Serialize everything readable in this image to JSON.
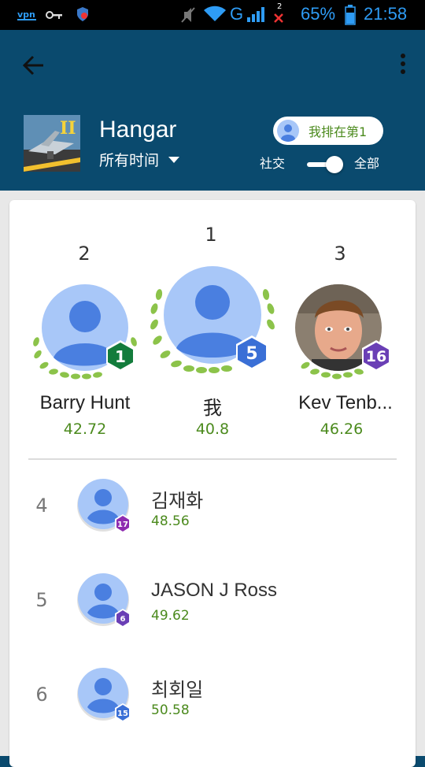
{
  "status_bar": {
    "battery": "65%",
    "time": "21:58",
    "signal_letter": "G",
    "notify_count": "2",
    "icons": [
      "vpn-icon",
      "key-icon",
      "shield-icon",
      "mute-icon",
      "wifi-icon",
      "signal-icon",
      "no-data-icon",
      "battery-icon"
    ]
  },
  "app_bar": {
    "back_icon": "back-arrow-icon",
    "menu_icon": "more-vert-icon",
    "game_title": "Hangar",
    "time_filter": "所有时间",
    "rank_chip": "我排在第1",
    "toggle_left": "社交",
    "toggle_right": "全部",
    "thumb_badge": "II"
  },
  "colors": {
    "app_bar": "#0a4a6e",
    "score_green": "#4b8a1d",
    "laurel": "#8cc34a",
    "avatar_bg": "#a8c7f8",
    "avatar_fg": "#4a7fe0"
  },
  "podium": [
    {
      "rank": "2",
      "name": "Barry Hunt",
      "score": "42.72",
      "level": "1",
      "badge_color": "#137c3c"
    },
    {
      "rank": "1",
      "name": "我",
      "score": "40.8",
      "level": "5",
      "badge_color": "#3a6fd6"
    },
    {
      "rank": "3",
      "name": "Kev Tenb...",
      "score": "46.26",
      "level": "16",
      "badge_color": "#6a3fb5"
    }
  ],
  "list": [
    {
      "rank": "4",
      "name": "김재화",
      "score": "48.56",
      "level": "17",
      "badge_color": "#8e2bb0"
    },
    {
      "rank": "5",
      "name": "JASON J Ross",
      "score": "49.62",
      "level": "6",
      "badge_color": "#6a3fb5"
    },
    {
      "rank": "6",
      "name": "최회일",
      "score": "50.58",
      "level": "15",
      "badge_color": "#3a6fd6"
    }
  ]
}
